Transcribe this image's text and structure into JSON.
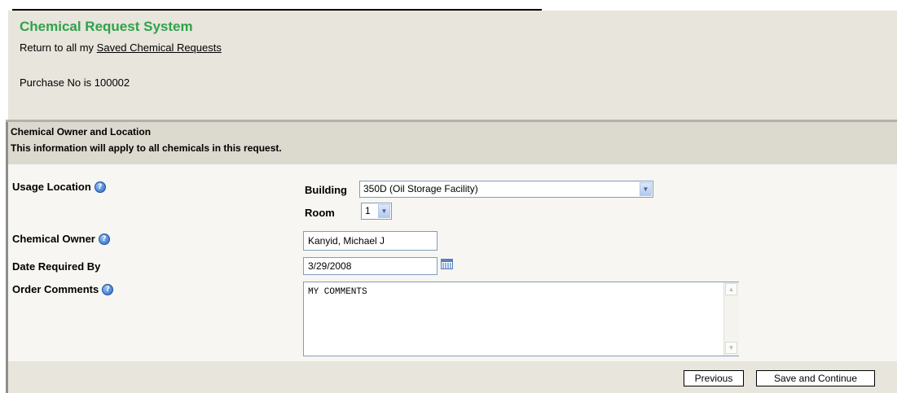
{
  "header": {
    "app_title": "Chemical Request System",
    "return_prefix": "Return to all my",
    "return_link": "Saved Chemical Requests",
    "purchase_text": "Purchase No is 100002"
  },
  "section": {
    "title": "Chemical Owner and Location",
    "subtitle": "This information will apply to all chemicals in this request."
  },
  "form": {
    "usage_location_label": "Usage Location",
    "building_label": "Building",
    "building_value": "350D (Oil Storage Facility)",
    "room_label": "Room",
    "room_value": "1",
    "chemical_owner_label": "Chemical Owner",
    "chemical_owner_value": "Kanyid, Michael J",
    "date_required_label": "Date Required By",
    "date_required_value": "3/29/2008",
    "order_comments_label": "Order Comments",
    "order_comments_value": "MY COMMENTS"
  },
  "buttons": {
    "previous": "Previous",
    "save_continue": "Save and Continue"
  },
  "icons": {
    "help": "help-icon",
    "calendar": "calendar-icon",
    "dropdown": "chevron-down-icon"
  }
}
